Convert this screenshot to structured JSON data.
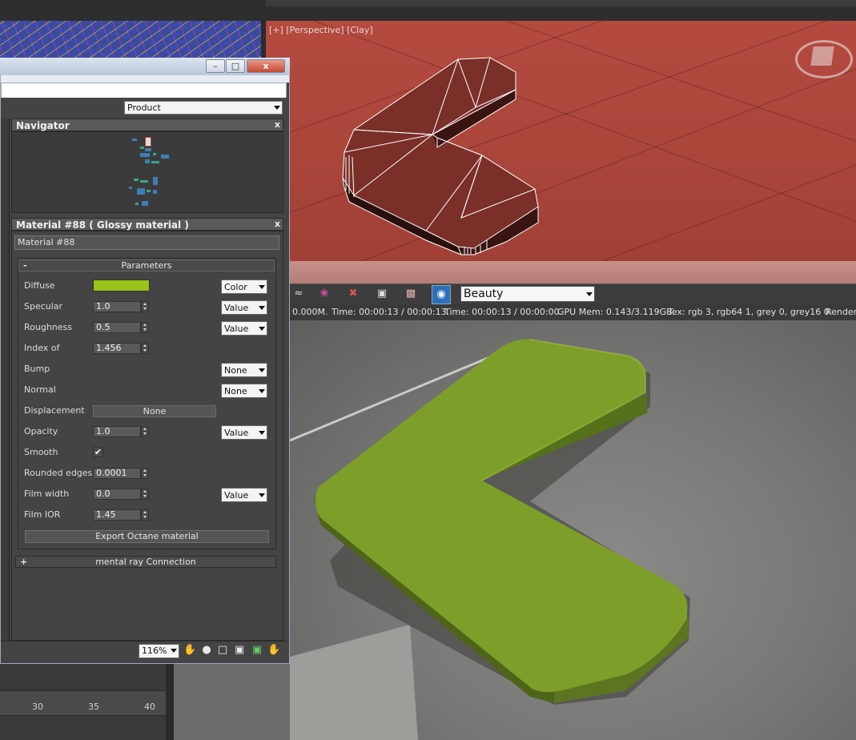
{
  "viewport": {
    "label_plus": "[+]",
    "label_view": "[Perspective]",
    "label_shading": "[Clay]"
  },
  "navigator": {
    "title": "Navigator",
    "close": "x"
  },
  "window": {
    "btn_min": "–",
    "btn_max": "□",
    "btn_close": "x",
    "mode_select": "Product"
  },
  "material": {
    "title": "Material #88  ( Glossy material )",
    "close": "x",
    "name_value": "Material #88",
    "params_title": "Parameters",
    "params_sign": "-",
    "diffuse_color": "#97c417",
    "rows": {
      "diffuse": {
        "label": "Diffuse",
        "mode": "Color"
      },
      "specular": {
        "label": "Specular",
        "value": "1.0",
        "mode": "Value"
      },
      "roughness": {
        "label": "Roughness",
        "value": "0.5",
        "mode": "Value"
      },
      "index": {
        "label": "Index of",
        "value": "1.456"
      },
      "bump": {
        "label": "Bump",
        "mode": "None"
      },
      "normal": {
        "label": "Normal",
        "mode": "None"
      },
      "displacement": {
        "label": "Displacement",
        "button": "None"
      },
      "opacity": {
        "label": "Opacity",
        "value": "1.0",
        "mode": "Value"
      },
      "smooth": {
        "label": "Smooth",
        "checked": "✔"
      },
      "rounded": {
        "label": "Rounded edges",
        "value": "0.0001"
      },
      "film_width": {
        "label": "Film width",
        "value": "0.0",
        "mode": "Value"
      },
      "film_ior": {
        "label": "Film IOR",
        "value": "1.45"
      }
    },
    "export_button": "Export Octane material",
    "mr_title": "mental ray Connection",
    "mr_sign": "+"
  },
  "bottombar": {
    "zoom": "116%",
    "icons": [
      "hand-icon",
      "add-node-icon",
      "select-region-icon",
      "fit-icon",
      "fit-selected-icon",
      "pan-icon"
    ]
  },
  "octane": {
    "pass_select": "Beauty",
    "status": {
      "mem": "0.000M.",
      "time1": "Time: 00:00:13 / 00:00:13.",
      "time2": "Time: 00:00:13 / 00:00:00.",
      "gpu": "GPU Mem: 0.143/3.119GB.",
      "tex": "Tex: rgb 3, rgb64 1, grey 0, grey16 0.",
      "render": "Render"
    }
  },
  "timeline": {
    "ticks": [
      "30",
      "35",
      "40"
    ]
  }
}
